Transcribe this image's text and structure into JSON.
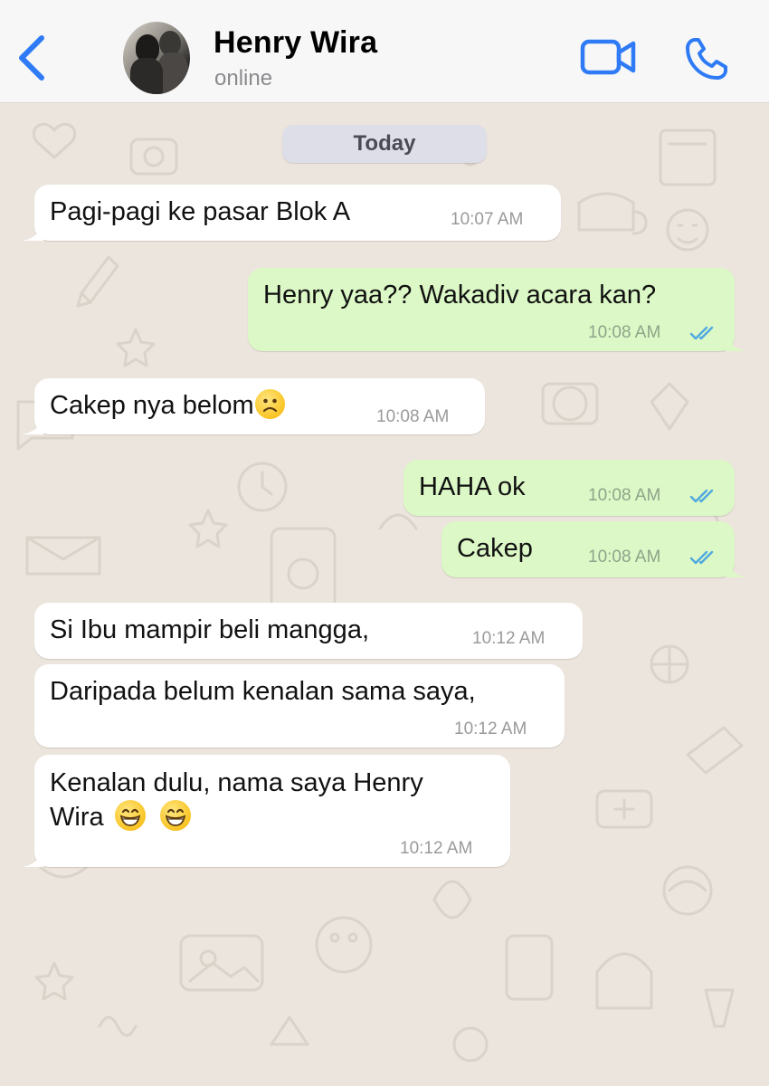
{
  "header": {
    "contact_name": "Henry Wira",
    "status": "online",
    "icons": [
      "chevron-left-icon",
      "video-camera-icon",
      "phone-icon"
    ],
    "accent_color": "#2F7BF6"
  },
  "chat": {
    "day_label": "Today",
    "colors": {
      "incoming": "#FFFFFF",
      "outgoing": "#DCF8C6",
      "read_tick": "#4FA8E0"
    },
    "messages": [
      {
        "direction": "in",
        "text": "Pagi-pagi ke pasar Blok A",
        "time": "10:07 AM"
      },
      {
        "direction": "out",
        "text": "Henry yaa?? Wakadiv acara kan?",
        "time": "10:08 AM",
        "status": "read"
      },
      {
        "direction": "in",
        "text": "Cakep nya belom",
        "emoji": "frowning-face",
        "time": "10:08 AM"
      },
      {
        "direction": "out",
        "text": "HAHA ok",
        "time": "10:08 AM",
        "status": "read"
      },
      {
        "direction": "out",
        "text": "Cakep",
        "time": "10:08 AM",
        "status": "read"
      },
      {
        "direction": "in",
        "text": "Si Ibu mampir beli mangga,",
        "time": "10:12 AM"
      },
      {
        "direction": "in",
        "text": "Daripada belum kenalan sama saya,",
        "time": "10:12 AM"
      },
      {
        "direction": "in",
        "text_line1": "Kenalan dulu, nama saya Henry",
        "text_line2": "Wira",
        "emoji": "grinning-face-x2",
        "time": "10:12 AM"
      }
    ]
  }
}
